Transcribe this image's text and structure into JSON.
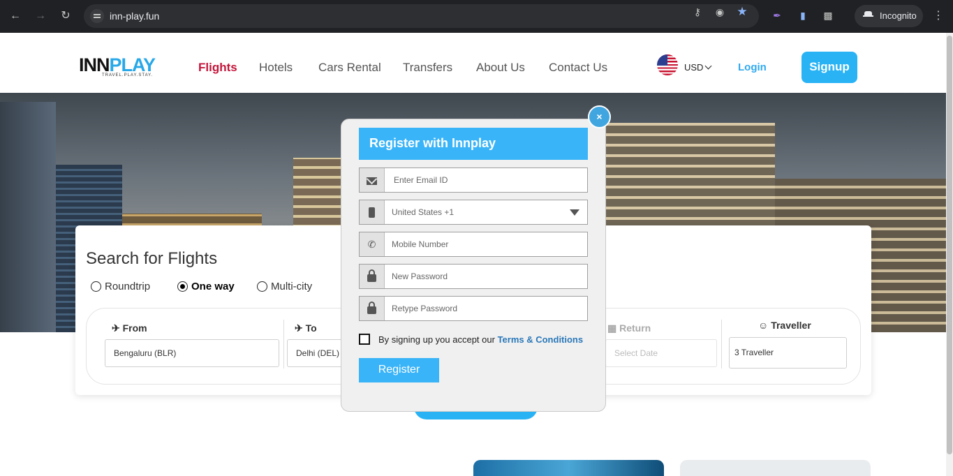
{
  "browser": {
    "url": "inn-play.fun",
    "incognito_label": "Incognito"
  },
  "header": {
    "logo_word_a": "INN",
    "logo_word_b": "PLAY",
    "logo_tagline": "TRAVEL.PLAY.STAY.",
    "nav": [
      "Flights",
      "Hotels",
      "Cars Rental",
      "Transfers",
      "About Us",
      "Contact Us"
    ],
    "active_nav": "Flights",
    "currency": "USD",
    "login": "Login",
    "signup": "Signup"
  },
  "search": {
    "title": "Search for Flights",
    "trip_types": [
      "Roundtrip",
      "One way",
      "Multi-city"
    ],
    "selected_trip_type": "One way",
    "from_label": "From",
    "from_value": "Bengaluru (BLR)",
    "to_label": "To",
    "to_value": "Delhi (DEL)",
    "return_label": "Return",
    "return_placeholder": "Select Date",
    "traveller_label": "Traveller",
    "traveller_value": "3 Traveller"
  },
  "modal": {
    "close": "×",
    "title": "Register with Innplay",
    "email_placeholder": "Enter Email ID",
    "country_value": "United States +1",
    "mobile_placeholder": "Mobile Number",
    "password_placeholder": "New Password",
    "retype_placeholder": "Retype Password",
    "terms_prefix": "By signing up you accept our",
    "terms_link": "Terms & Conditions",
    "register": "Register"
  },
  "colors": {
    "brand_blue": "#29b3f5",
    "active_red": "#c4153a"
  }
}
